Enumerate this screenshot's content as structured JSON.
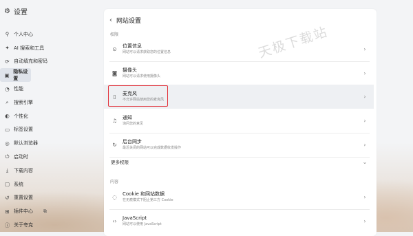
{
  "app": {
    "title": "设置",
    "icon": "gear-icon"
  },
  "sidebar": {
    "items": [
      {
        "label": "个人中心",
        "icon": "person-icon"
      },
      {
        "label": "AI 搜索和工具",
        "icon": "ai-spark-icon"
      },
      {
        "label": "自动填充和密码",
        "icon": "autofill-icon"
      },
      {
        "label": "隐私设置",
        "icon": "privacy-icon",
        "active": true
      },
      {
        "label": "性能",
        "icon": "performance-icon"
      },
      {
        "label": "搜索引擎",
        "icon": "search-icon"
      },
      {
        "label": "个性化",
        "icon": "palette-icon"
      },
      {
        "label": "标签设置",
        "icon": "tab-icon"
      },
      {
        "label": "默认浏览器",
        "icon": "browser-icon"
      },
      {
        "label": "启动时",
        "icon": "power-icon"
      },
      {
        "label": "下载内容",
        "icon": "download-icon"
      },
      {
        "label": "系统",
        "icon": "system-icon"
      },
      {
        "label": "重置设置",
        "icon": "reset-icon"
      },
      {
        "label": "插件中心",
        "icon": "extensions-icon",
        "external": "open-external-icon"
      },
      {
        "label": "关于夸克",
        "icon": "info-icon"
      }
    ]
  },
  "panel": {
    "title": "网站设置",
    "watermark": "天极下载站",
    "permissions_label": "权限",
    "rows": [
      {
        "title": "位置信息",
        "desc": "网站可以请求获取您的位置信息",
        "icon": "location-icon"
      },
      {
        "title": "摄像头",
        "desc": "网站可以请求使用摄像头",
        "icon": "camera-icon"
      },
      {
        "title": "麦克风",
        "desc": "不允许网站使用您的麦克风",
        "icon": "microphone-icon",
        "highlight": true
      },
      {
        "title": "通知",
        "desc": "询问您的意见",
        "icon": "bell-icon"
      },
      {
        "title": "后台同步",
        "desc": "最近关闭的网站可以完成数据收发操作",
        "icon": "sync-icon"
      }
    ],
    "more_permissions": "更多权限",
    "content_label": "内容",
    "content_rows": [
      {
        "title": "Cookie 和网站数据",
        "desc": "在无痕模式下阻止第三方 Cookie",
        "icon": "cookie-icon"
      },
      {
        "title": "JavaScript",
        "desc": "网站可以使用 JavaScript",
        "icon": "code-icon"
      }
    ]
  },
  "colors": {
    "highlight_border": "#e2323a",
    "panel_bg": "#ffffff",
    "page_bg": "#f3f4f6"
  }
}
